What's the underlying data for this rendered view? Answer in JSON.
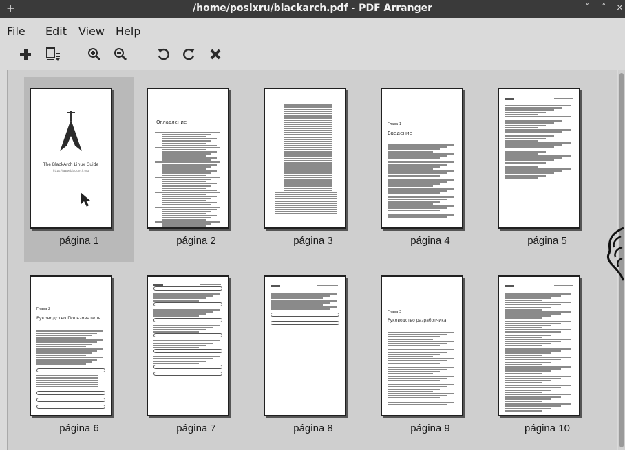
{
  "window": {
    "title": "/home/posixru/blackarch.pdf - PDF Arranger",
    "plus_glyph": "+",
    "minimize_glyph": "˅",
    "maximize_glyph": "˄",
    "close_glyph": "×"
  },
  "menu": {
    "file": "File",
    "edit": "Edit",
    "view": "View",
    "help": "Help"
  },
  "toolbar": {
    "add": "add-icon",
    "insert": "insert-page-icon",
    "zoom_in": "zoom-in-icon",
    "zoom_out": "zoom-out-icon",
    "rotate_left": "rotate-left-icon",
    "rotate_right": "rotate-right-icon",
    "delete": "delete-icon"
  },
  "pages": [
    {
      "label": "página 1",
      "kind": "cover",
      "cover_title": "The BlackArch Linux Guide",
      "cover_url": "https://www.blackarch.org"
    },
    {
      "label": "página 2",
      "kind": "toc",
      "heading": "Оглавление"
    },
    {
      "label": "página 3",
      "kind": "toc2"
    },
    {
      "label": "página 4",
      "kind": "chapter",
      "chapter": "Глава 1",
      "heading": "Введение"
    },
    {
      "label": "página 5",
      "kind": "text"
    },
    {
      "label": "página 6",
      "kind": "chapter",
      "chapter": "Глава 2",
      "heading": "Руководство Пользователя"
    },
    {
      "label": "página 7",
      "kind": "boxed"
    },
    {
      "label": "página 8",
      "kind": "boxed2"
    },
    {
      "label": "página 9",
      "kind": "chapter",
      "chapter": "Глава 3",
      "heading": "Руководство разработчика"
    },
    {
      "label": "página 10",
      "kind": "text2"
    }
  ],
  "selected_page": 1,
  "colors": {
    "accent_selection": "#b9b9b9",
    "titlebar": "#3a3a3a"
  }
}
